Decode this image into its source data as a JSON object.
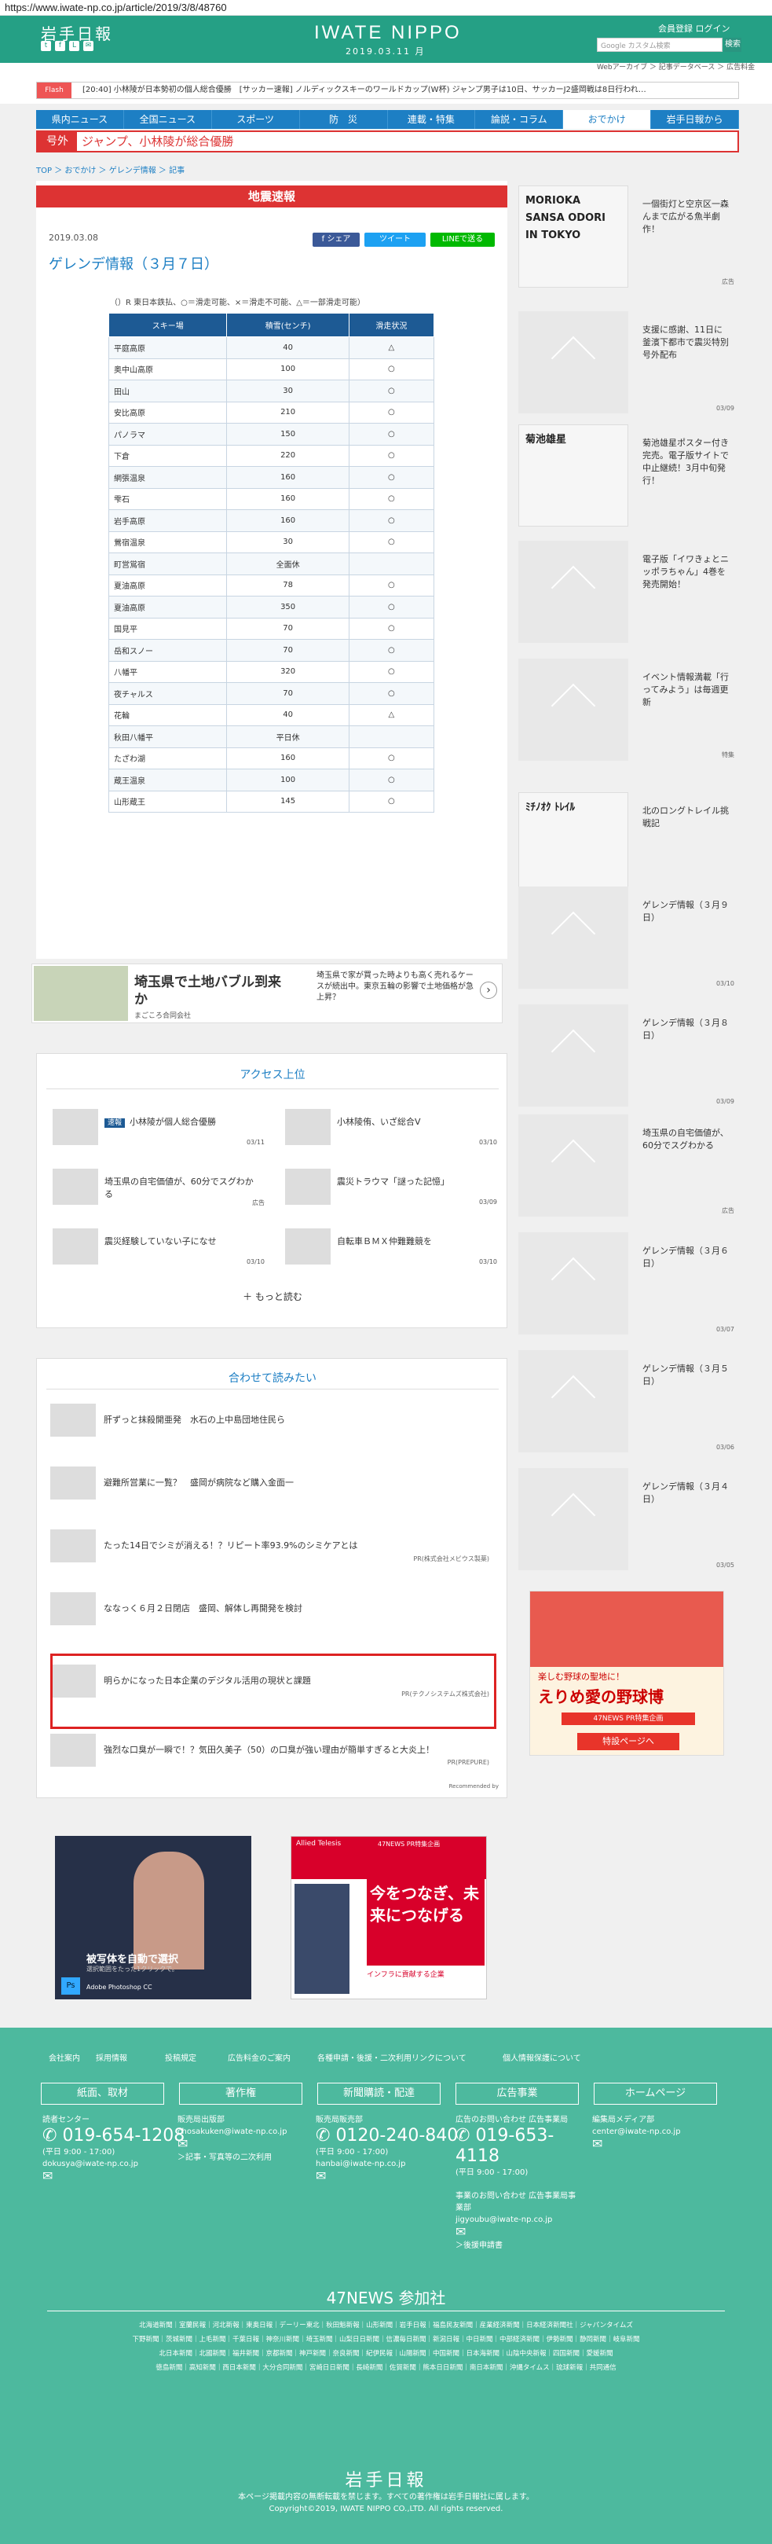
{
  "url": "https://www.iwate-np.co.jp/article/2019/3/8/48760",
  "header": {
    "logo": "岩手日報",
    "brand": "IWATE NIPPO",
    "date": "2019.03.11 月",
    "links": "会員登録 ログイン",
    "search_placeholder": "Google カスタム検索",
    "search_btn": "検索",
    "webarchive": "Webアーカイブ ＞ 記事データベース ＞ 広告料金"
  },
  "ticker": {
    "label": "Flash",
    "text": "[20:40] 小林陵が日本勢初の個人総合優勝　[サッカー速報] ノルディックスキーのワールドカップ(W杯) ジャンプ男子は10日、サッカーJ2盛岡戦は8日行われ…"
  },
  "nav": [
    "県内ニュース",
    "全国ニュース",
    "スポーツ",
    "防　災",
    "連載・特集",
    "論説・コラム",
    "おでかけ",
    "岩手日報から"
  ],
  "gogai": {
    "tag": "号外",
    "text": "ジャンプ、小林陵が総合優勝"
  },
  "breadcrumb": "TOP ＞ おでかけ ＞ ゲレンデ情報 ＞ 記事",
  "article": {
    "banner": "地震速報",
    "date": "2019.03.08",
    "title": "ゲレンデ情報（３月７日）",
    "share_fb": "f シェア",
    "share_tw": "ツイート",
    "share_line": "LINEで送る",
    "legend": "（）R 東日本鉄払、○＝滑走可能、×＝滑走不可能、△＝一部滑走可能）"
  },
  "table": {
    "headers": [
      "スキー場",
      "積雪(センチ)",
      "滑走状況"
    ],
    "rows": [
      [
        "平庭高原",
        "40",
        "△"
      ],
      [
        "奥中山高原",
        "100",
        "○"
      ],
      [
        "田山",
        "30",
        "○"
      ],
      [
        "安比高原",
        "210",
        "○"
      ],
      [
        "パノラマ",
        "150",
        "○"
      ],
      [
        "下倉",
        "220",
        "○"
      ],
      [
        "網張温泉",
        "160",
        "○"
      ],
      [
        "雫石",
        "160",
        "○"
      ],
      [
        "岩手高原",
        "160",
        "○"
      ],
      [
        "鶯宿温泉",
        "30",
        "○"
      ],
      [
        "町営鴬宿",
        "全面休",
        ""
      ],
      [
        "夏油高原",
        "78",
        "○"
      ],
      [
        "夏油高原",
        "350",
        "○"
      ],
      [
        "国見平",
        "70",
        "○"
      ],
      [
        "岳和スノー",
        "70",
        "○"
      ],
      [
        "八幡平",
        "320",
        "○"
      ],
      [
        "夜チャルス",
        "70",
        "○"
      ],
      [
        "花輪",
        "40",
        "△"
      ],
      [
        "秋田八幡平",
        "平日休",
        ""
      ],
      [
        "たざわ湖",
        "160",
        "○"
      ],
      [
        "蔵王温泉",
        "100",
        "○"
      ],
      [
        "山形蔵王",
        "145",
        "○"
      ]
    ]
  },
  "ad1": {
    "title": "埼玉県で土地バブル到来か",
    "source": "まごころ合同会社",
    "body": "埼玉県で家が買った時よりも高く売れるケースが続出中。東京五輪の影響で土地価格が急上昇？"
  },
  "access": {
    "title": "アクセス上位",
    "more": "もっと読む",
    "items": [
      {
        "tag": "速報",
        "t": "小林陵が個人総合優勝",
        "d": "03/11"
      },
      {
        "t": "小林陵侑、いざ総合V",
        "d": "03/10"
      },
      {
        "t": "埼玉県の自宅価値が、60分でスグわかる",
        "d": "広告"
      },
      {
        "t": "震災トラウマ「謎った記憶」",
        "d": "03/09"
      },
      {
        "t": "震災経験していない子になせ",
        "d": "03/10"
      },
      {
        "t": "自転車ＢＭＸ仲難難競を",
        "d": "03/10"
      }
    ]
  },
  "related": {
    "title": "合わせて読みたい",
    "items": [
      {
        "t": "肝ずっと抹殺開亜発　水石の上中島団地住民ら",
        "pr": ""
      },
      {
        "t": "避難所営業に一覧？　盛岡が病院など購入金面一",
        "pr": ""
      },
      {
        "t": "たった14日でシミが消える！？リピート率93.9%のシミケアとは",
        "pr": "PR(株式会社メビウス製薬)"
      },
      {
        "t": "ななっく６月２日閉店　盛岡、解体し再開発を検討",
        "pr": ""
      },
      {
        "t": "明らかになった日本企業のデジタル活用の現状と課題",
        "pr": "PR(テクノシステムズ株式会社)"
      },
      {
        "t": "強烈な口臭が一瞬で！？気田久美子（50）の口臭が強い理由が簡単すぎると大炎上！",
        "pr": "PR(PREPURE)"
      }
    ],
    "recommended": "Recommended by"
  },
  "ads": {
    "ps_title": "被写体を自動で選択",
    "ps_sub": "選択範囲をたった1クリックで。",
    "ps_brand": "Adobe Photoshop CC",
    "at_head": "47NEWS PR特集企画",
    "at_main": "今をつなぎ、未来につなげる",
    "at_sub": "インフラに貢献する企業",
    "at_brand": "Allied Telesis"
  },
  "sidebar": [
    {
      "t": "一個街灯と空京区一森んまで広がる魚半劇作！",
      "img": "MORIOKA SANSA ODORI IN TOKYO",
      "foot": "広告"
    },
    {
      "t": "支援に感謝、11日に釜濱下都市で震災特別号外配布",
      "foot": "03/09"
    },
    {
      "t": "菊池雄星ポスター付き完売。電子版サイトで中止継続！3月中旬発行！",
      "img": "菊池雄星",
      "foot": ""
    },
    {
      "t": "電子版「イワきょとニッポラちゃん」4巻を発売開始！",
      "foot": ""
    },
    {
      "t": "イベント情報満載「行ってみよう」は毎週更新",
      "foot": "特集"
    },
    {
      "t": "北のロングトレイル挑戦記",
      "img": "ﾐﾁﾉｵｸ ﾄﾚｲﾙ",
      "foot": ""
    },
    {
      "t": "ゲレンデ情報（３月９日）",
      "foot": "03/10"
    },
    {
      "t": "ゲレンデ情報（３月８日）",
      "foot": "03/09"
    },
    {
      "t": "埼玉県の自宅価値が、60分でスグわかる",
      "foot": "広告"
    },
    {
      "t": "ゲレンデ情報（３月６日）",
      "foot": "03/07"
    },
    {
      "t": "ゲレンデ情報（３月５日）",
      "foot": "03/06"
    },
    {
      "t": "ゲレンデ情報（３月４日）",
      "foot": "03/05"
    }
  ],
  "sidead": {
    "t1": "楽しむ野球の聖地に！",
    "t2": "えりめ愛の野球博",
    "t3": "47NEWS PR特集企画",
    "btn": "特設ページへ"
  },
  "footer": {
    "top": [
      "会社案内",
      "採用情報",
      "投稿規定",
      "広告料金のご案内",
      "各種申請・後援・二次利用",
      "リンクについて",
      "個人情報保護について"
    ],
    "btns": [
      "紙面、取材",
      "著作権",
      "新聞購読・配達",
      "広告事業",
      "ホームページ"
    ],
    "c1": {
      "h": "読者センター",
      "tel": "019-654-1208",
      "hours": "(平日 9:00 - 17:00)",
      "mail": "dokusya@iwate-np.co.jp"
    },
    "c2": {
      "h": "販売局出版部",
      "mail": "chosakuken@iwate-np.co.jp",
      "link": "＞記事・写真等の二次利用"
    },
    "c3": {
      "h": "販売局販売部",
      "tel": "0120-240-840",
      "hours": "(平日 9:00 - 17:00)",
      "mail": "hanbai@iwate-np.co.jp"
    },
    "c4": {
      "h": "広告のお問い合わせ 広告事業局",
      "tel": "019-653-4118",
      "hours": "(平日 9:00 - 17:00)",
      "h2": "事業のお問い合わせ 広告事業局事業部",
      "mail": "jigyoubu@iwate-np.co.jp",
      "link": "＞後援申請書"
    },
    "c5": {
      "h": "編集局メディア部",
      "mail": "center@iwate-np.co.jp"
    },
    "n47": "47NEWS 参加社",
    "papers1": "北海道新聞｜室蘭民報｜河北新報｜東奥日報｜デーリー東北｜秋田魁新報｜山形新聞｜岩手日報｜福島民友新聞｜産業経済新聞｜日本経済新聞社｜ジャパンタイムズ",
    "papers2": "下野新聞｜茨城新聞｜上毛新聞｜千葉日報｜神奈川新聞｜埼玉新聞｜山梨日日新聞｜信濃毎日新聞｜新潟日報｜中日新聞｜中部経済新聞｜伊勢新聞｜静岡新聞｜岐阜新聞",
    "papers3": "北日本新聞｜北國新聞｜福井新聞｜京都新聞｜神戸新聞｜奈良新聞｜紀伊民報｜山陽新聞｜中国新聞｜日本海新聞｜山陰中央新報｜四国新聞｜愛媛新聞",
    "papers4": "徳島新聞｜高知新聞｜西日本新聞｜大分合同新聞｜宮崎日日新聞｜長崎新聞｜佐賀新聞｜熊本日日新聞｜南日本新聞｜沖縄タイムス｜琉球新報｜共同通信",
    "logo": "岩手日報",
    "copy1": "本ページ掲載内容の無断転載を禁じます。すべての著作権は岩手日報社に属します。",
    "copy2": "Copyright©2019, IWATE NIPPO CO.,LTD. All rights reserved."
  }
}
